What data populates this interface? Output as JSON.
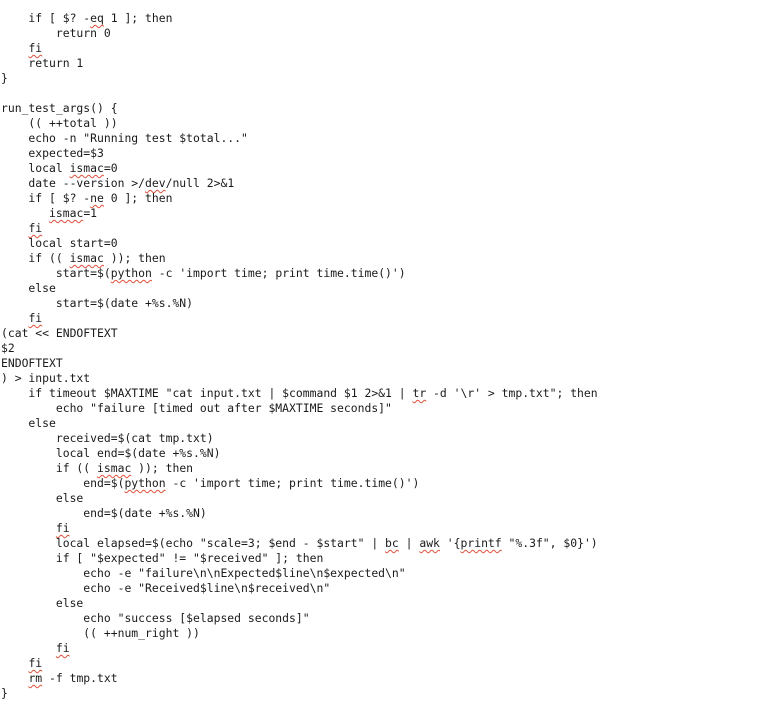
{
  "document": {
    "language": "bash",
    "spellcheck_color": "#e0503a",
    "lines": [
      {
        "text": "    if [ $? -eq 1 ]; then",
        "squiggles": [
          "eq"
        ]
      },
      {
        "text": "        return 0",
        "squiggles": []
      },
      {
        "text": "    fi",
        "squiggles": [
          "fi"
        ]
      },
      {
        "text": "    return 1",
        "squiggles": []
      },
      {
        "text": "}",
        "squiggles": []
      },
      {
        "text": "",
        "squiggles": []
      },
      {
        "text": "run_test_args() {",
        "squiggles": []
      },
      {
        "text": "    (( ++total ))",
        "squiggles": []
      },
      {
        "text": "    echo -n \"Running test $total...\"",
        "squiggles": []
      },
      {
        "text": "    expected=$3",
        "squiggles": []
      },
      {
        "text": "    local ismac=0",
        "squiggles": [
          "ismac"
        ]
      },
      {
        "text": "    date --version >/dev/null 2>&1",
        "squiggles": [
          "dev"
        ]
      },
      {
        "text": "    if [ $? -ne 0 ]; then",
        "squiggles": [
          "ne"
        ]
      },
      {
        "text": "       ismac=1",
        "squiggles": [
          "ismac"
        ]
      },
      {
        "text": "    fi",
        "squiggles": [
          "fi"
        ]
      },
      {
        "text": "    local start=0",
        "squiggles": []
      },
      {
        "text": "    if (( ismac )); then",
        "squiggles": [
          "ismac"
        ]
      },
      {
        "text": "        start=$(python -c 'import time; print time.time()')",
        "squiggles": [
          "python"
        ]
      },
      {
        "text": "    else",
        "squiggles": []
      },
      {
        "text": "        start=$(date +%s.%N)",
        "squiggles": []
      },
      {
        "text": "    fi",
        "squiggles": [
          "fi"
        ]
      },
      {
        "text": "(cat << ENDOFTEXT",
        "squiggles": []
      },
      {
        "text": "$2",
        "squiggles": []
      },
      {
        "text": "ENDOFTEXT",
        "squiggles": []
      },
      {
        "text": ") > input.txt",
        "squiggles": []
      },
      {
        "text": "    if timeout $MAXTIME \"cat input.txt | $command $1 2>&1 | tr -d '\\r' > tmp.txt\"; then",
        "squiggles": [
          "tr"
        ]
      },
      {
        "text": "        echo \"failure [timed out after $MAXTIME seconds]\"",
        "squiggles": []
      },
      {
        "text": "    else",
        "squiggles": []
      },
      {
        "text": "        received=$(cat tmp.txt)",
        "squiggles": []
      },
      {
        "text": "        local end=$(date +%s.%N)",
        "squiggles": []
      },
      {
        "text": "        if (( ismac )); then",
        "squiggles": [
          "ismac"
        ]
      },
      {
        "text": "            end=$(python -c 'import time; print time.time()')",
        "squiggles": [
          "python"
        ]
      },
      {
        "text": "        else",
        "squiggles": []
      },
      {
        "text": "            end=$(date +%s.%N)",
        "squiggles": []
      },
      {
        "text": "        fi",
        "squiggles": [
          "fi"
        ]
      },
      {
        "text": "        local elapsed=$(echo \"scale=3; $end - $start\" | bc | awk '{printf \"%.3f\", $0}')",
        "squiggles": [
          "bc",
          "awk",
          "printf"
        ]
      },
      {
        "text": "        if [ \"$expected\" != \"$received\" ]; then",
        "squiggles": []
      },
      {
        "text": "            echo -e \"failure\\n\\nExpected$line\\n$expected\\n\"",
        "squiggles": []
      },
      {
        "text": "            echo -e \"Received$line\\n$received\\n\"",
        "squiggles": []
      },
      {
        "text": "        else",
        "squiggles": []
      },
      {
        "text": "            echo \"success [$elapsed seconds]\"",
        "squiggles": []
      },
      {
        "text": "            (( ++num_right ))",
        "squiggles": []
      },
      {
        "text": "        fi",
        "squiggles": [
          "fi"
        ]
      },
      {
        "text": "    fi",
        "squiggles": [
          "fi"
        ]
      },
      {
        "text": "    rm -f tmp.txt",
        "squiggles": [
          "rm"
        ]
      },
      {
        "text": "}",
        "squiggles": []
      }
    ]
  }
}
